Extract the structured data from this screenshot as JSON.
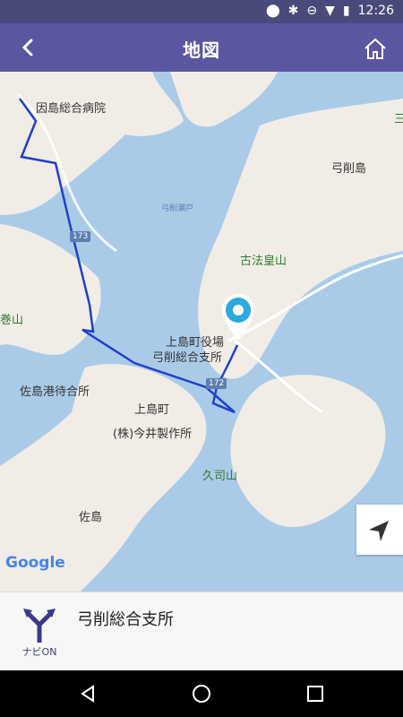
{
  "status": {
    "time": "12:26"
  },
  "appbar": {
    "title": "地図"
  },
  "map": {
    "labels": {
      "hospital": "因島総合病院",
      "yugeshima": "弓削島",
      "yuge_strait": "弓削瀬戸",
      "kohou": "古法皇山",
      "mount_left": "巻山",
      "kamijima_office": "上島町役場",
      "yuge_branch": "弓削総合支所",
      "sashima_port": "佐島港待合所",
      "kamijima_town": "上島町",
      "imai": "(株)今井製作所",
      "kushi": "久司山",
      "sashima": "佐島",
      "route173": "173",
      "route172": "172",
      "partial_right": "三"
    },
    "attribution": "Google"
  },
  "panel": {
    "navi_label": "ナビON",
    "place_name": "弓削総合支所"
  }
}
